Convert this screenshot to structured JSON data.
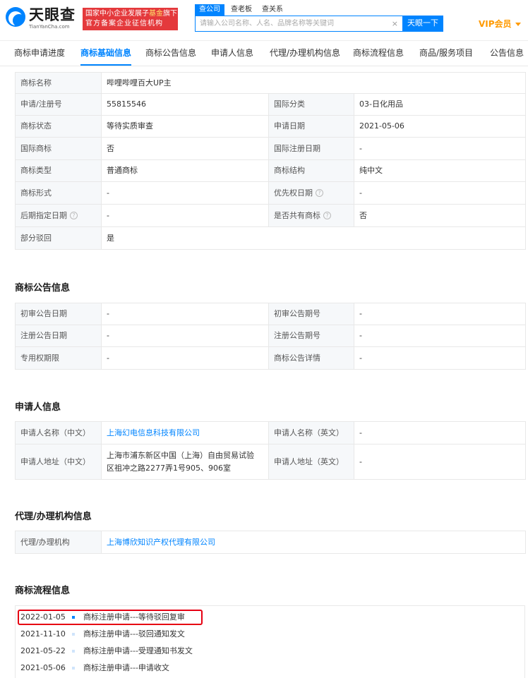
{
  "header": {
    "logo_text": "天眼查",
    "logo_sub": "TianYanCha.com",
    "banner_line1_a": "国家中小企业发展子",
    "banner_line1_b": "基金",
    "banner_line1_c": "旗下",
    "banner_line2": "官方备案企业征信机构",
    "search_tabs": [
      "查公司",
      "查老板",
      "查关系"
    ],
    "search_placeholder": "请输入公司名称、人名、品牌名称等关键词",
    "search_clear": "×",
    "search_button": "天眼一下",
    "vip": "VIP会员"
  },
  "tabs": [
    "商标申请进度",
    "商标基础信息",
    "商标公告信息",
    "申请人信息",
    "代理/办理机构信息",
    "商标流程信息",
    "商品/服务项目",
    "公告信息"
  ],
  "basic": {
    "name_label": "商标名称",
    "name_value": "哔哩哔哩百大UP主",
    "reg_no_label": "申请/注册号",
    "reg_no_value": "55815546",
    "intl_class_label": "国际分类",
    "intl_class_value": "03-日化用品",
    "status_label": "商标状态",
    "status_value": "等待实质审查",
    "apply_date_label": "申请日期",
    "apply_date_value": "2021-05-06",
    "intl_tm_label": "国际商标",
    "intl_tm_value": "否",
    "intl_reg_date_label": "国际注册日期",
    "intl_reg_date_value": "-",
    "type_label": "商标类型",
    "type_value": "普通商标",
    "structure_label": "商标结构",
    "structure_value": "纯中文",
    "form_label": "商标形式",
    "form_value": "-",
    "priority_label": "优先权日期",
    "priority_value": "-",
    "later_label": "后期指定日期",
    "later_value": "-",
    "shared_label": "是否共有商标",
    "shared_value": "否",
    "partial_label": "部分驳回",
    "partial_value": "是",
    "question_mark": "?"
  },
  "announcement": {
    "title": "商标公告信息",
    "prelim_date_label": "初审公告日期",
    "prelim_date_value": "-",
    "prelim_no_label": "初审公告期号",
    "prelim_no_value": "-",
    "reg_date_label": "注册公告日期",
    "reg_date_value": "-",
    "reg_no_label": "注册公告期号",
    "reg_no_value": "-",
    "exclusive_label": "专用权期限",
    "exclusive_value": "-",
    "detail_label": "商标公告详情",
    "detail_value": "-"
  },
  "applicant": {
    "title": "申请人信息",
    "name_cn_label": "申请人名称（中文）",
    "name_cn_value": "上海幻电信息科技有限公司",
    "name_en_label": "申请人名称（英文）",
    "name_en_value": "-",
    "addr_cn_label": "申请人地址（中文）",
    "addr_cn_line1": "上海市浦东新区中国（上海）自由贸易试验",
    "addr_cn_line2": "区祖冲之路2277弄1号905、906室",
    "addr_en_label": "申请人地址（英文）",
    "addr_en_value": "-"
  },
  "agent": {
    "title": "代理/办理机构信息",
    "label": "代理/办理机构",
    "value": "上海博欣知识产权代理有限公司"
  },
  "flow": {
    "title": "商标流程信息",
    "items": [
      {
        "date": "2022-01-05",
        "text": "商标注册申请---等待驳回复审"
      },
      {
        "date": "2021-11-10",
        "text": "商标注册申请---驳回通知发文"
      },
      {
        "date": "2021-05-22",
        "text": "商标注册申请---受理通知书发文"
      },
      {
        "date": "2021-05-06",
        "text": "商标注册申请---申请收文"
      }
    ]
  },
  "colors": {
    "accent": "#0084ff",
    "banner": "#e4393c",
    "vip": "#ff9a00",
    "highlight": "#e60012"
  }
}
